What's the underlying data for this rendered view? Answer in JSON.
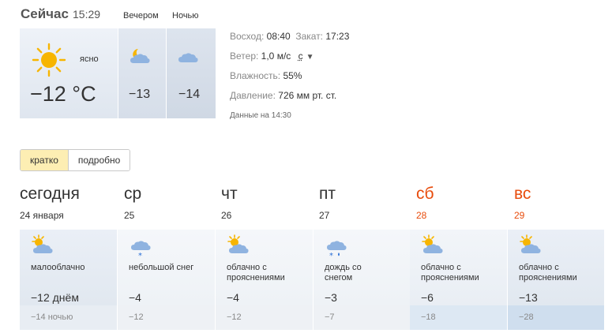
{
  "now": {
    "title": "Сейчас",
    "time": "15:29",
    "condition": "ясно",
    "temp": "−12 °C",
    "icon": "sun-icon"
  },
  "evening": {
    "label": "Вечером",
    "temp": "−13",
    "icon": "moon-cloud-icon"
  },
  "night": {
    "label": "Ночью",
    "temp": "−14",
    "icon": "cloud-icon"
  },
  "details": {
    "sunrise_label": "Восход:",
    "sunrise": "08:40",
    "sunset_label": "Закат:",
    "sunset": "17:23",
    "wind_label": "Ветер:",
    "wind": "1,0 м/с",
    "wind_dir": "с",
    "humidity_label": "Влажность:",
    "humidity": "55%",
    "pressure_label": "Давление:",
    "pressure": "726 мм рт. ст.",
    "data_time": "Данные на 14:30"
  },
  "tabs": [
    {
      "label": "кратко",
      "active": true
    },
    {
      "label": "подробно",
      "active": false
    }
  ],
  "forecast": [
    {
      "day": "сегодня",
      "date": "24 января",
      "weekend": false,
      "icon": "partly-cloudy-icon",
      "condition": [
        "малооблачно"
      ],
      "temp_day": "−12 днём",
      "temp_night": "−14 ночью"
    },
    {
      "day": "ср",
      "date": "25",
      "weekend": false,
      "icon": "light-snow-icon",
      "condition": [
        "небольшой снег"
      ],
      "temp_day": "−4",
      "temp_night": "−12"
    },
    {
      "day": "чт",
      "date": "26",
      "weekend": false,
      "icon": "partly-cloudy-icon",
      "condition": [
        "облачно с",
        "прояснениями"
      ],
      "temp_day": "−4",
      "temp_night": "−12"
    },
    {
      "day": "пт",
      "date": "27",
      "weekend": false,
      "icon": "rain-snow-icon",
      "condition": [
        "дождь со",
        "снегом"
      ],
      "temp_day": "−3",
      "temp_night": "−7"
    },
    {
      "day": "сб",
      "date": "28",
      "weekend": true,
      "icon": "partly-cloudy-icon",
      "condition": [
        "облачно с",
        "прояснениями"
      ],
      "temp_day": "−6",
      "temp_night": "−18"
    },
    {
      "day": "вс",
      "date": "29",
      "weekend": true,
      "icon": "partly-cloudy-icon",
      "condition": [
        "облачно с",
        "прояснениями"
      ],
      "temp_day": "−13",
      "temp_night": "−28"
    }
  ],
  "colors": {
    "weekend": "#e84c0c",
    "active_tab": "#fdeeb3",
    "sun": "#f7b500",
    "cloud": "#8fb3e0"
  }
}
